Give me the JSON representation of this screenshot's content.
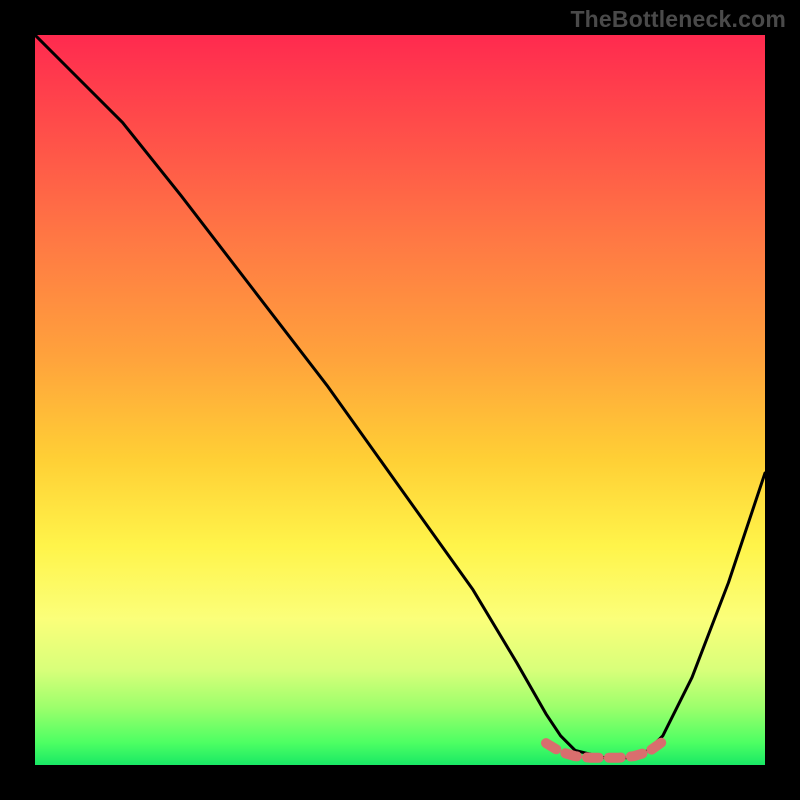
{
  "watermark": "TheBottleneck.com",
  "chart_data": {
    "type": "line",
    "title": "",
    "xlabel": "",
    "ylabel": "",
    "xlim": [
      0,
      100
    ],
    "ylim": [
      0,
      100
    ],
    "grid": false,
    "series": [
      {
        "name": "bottleneck-curve",
        "color": "#000000",
        "x": [
          0,
          5,
          12,
          20,
          30,
          40,
          50,
          60,
          66,
          70,
          72,
          74,
          78,
          82,
          84,
          86,
          90,
          95,
          100
        ],
        "y": [
          100,
          95,
          88,
          78,
          65,
          52,
          38,
          24,
          14,
          7,
          4,
          2,
          1,
          1,
          2,
          4,
          12,
          25,
          40
        ]
      },
      {
        "name": "optimal-range-marker",
        "color": "#d96e6e",
        "x": [
          70,
          72,
          74,
          76,
          78,
          80,
          82,
          84,
          86
        ],
        "y": [
          3.0,
          1.8,
          1.2,
          1.0,
          1.0,
          1.0,
          1.2,
          1.8,
          3.2
        ]
      }
    ],
    "background_gradient": {
      "top": "#ff2a4f",
      "upper_mid": "#ff9a3e",
      "mid": "#fff44a",
      "lower_mid": "#bfff70",
      "bottom": "#19e865"
    }
  }
}
